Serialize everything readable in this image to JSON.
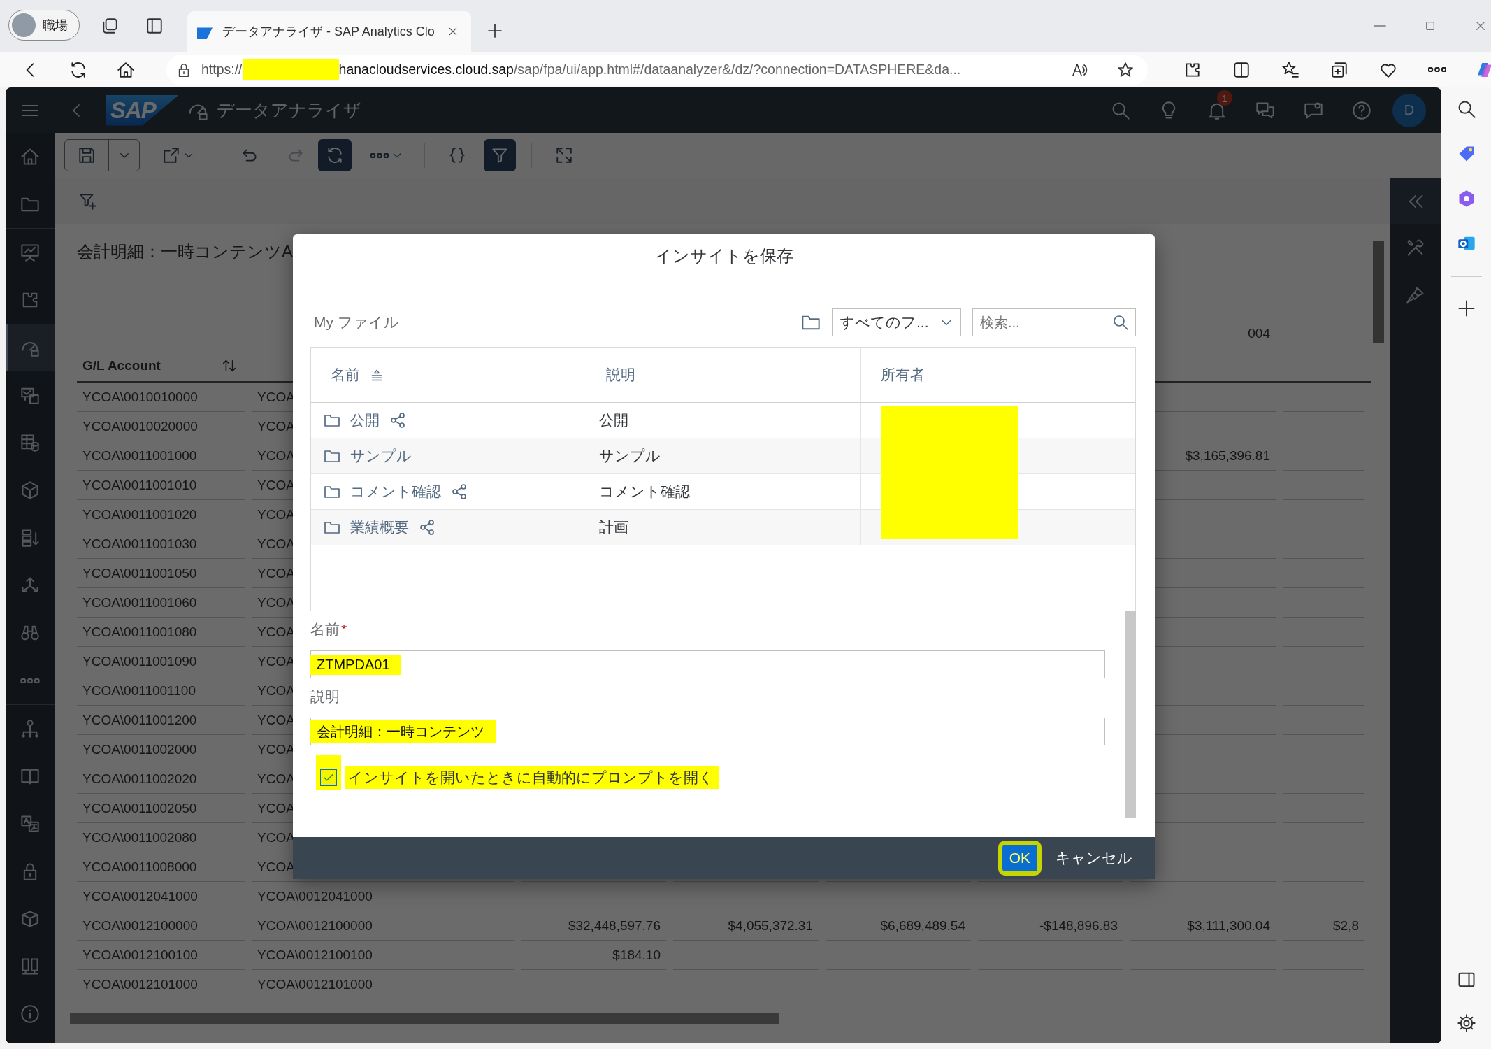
{
  "browser": {
    "profile": {
      "label": "職場"
    },
    "tabs": [
      {
        "title": "データアナライザ - SAP Analytics Clo",
        "selected": true
      }
    ],
    "address": {
      "scheme": "https://",
      "host_redacted": true,
      "host": "hanacloudservices.cloud.sap",
      "path": "/sap/fpa/ui/app.html#/dataanalyzer&/dz/?connection=DATASPHERE&da..."
    }
  },
  "shell": {
    "logo": "SAP",
    "title": "データアナライザ",
    "notification_count": "1",
    "avatar": "D"
  },
  "nav": [
    {
      "selected": false
    },
    {
      "selected": false
    },
    {
      "selected": false
    },
    {
      "selected": false
    },
    {
      "selected": true
    },
    {
      "selected": false
    },
    {
      "selected": false
    },
    {
      "selected": false
    },
    {
      "selected": false
    },
    {
      "selected": false
    },
    {
      "selected": false
    },
    {
      "selected": false
    },
    {
      "selected": false
    },
    {
      "selected": false
    },
    {
      "selected": false
    },
    {
      "selected": false
    },
    {
      "selected": false
    },
    {
      "selected": false
    },
    {
      "selected": false
    }
  ],
  "toolbar": [
    {
      "kind": "save",
      "active": false,
      "disabled": false
    },
    {
      "kind": "export",
      "active": false,
      "disabled": false
    },
    {
      "kind": "undo",
      "active": false,
      "disabled": false
    },
    {
      "kind": "redo",
      "active": false,
      "disabled": true
    },
    {
      "kind": "refresh",
      "active": true,
      "disabled": false
    },
    {
      "kind": "more",
      "active": false,
      "disabled": false
    },
    {
      "kind": "formula",
      "active": false,
      "disabled": false
    },
    {
      "kind": "filter",
      "active": true,
      "disabled": false
    },
    {
      "kind": "fullscreen",
      "active": false,
      "disabled": false
    }
  ],
  "report": {
    "title": "会計明細：一時コンテンツA",
    "account_header": "G/L Account",
    "period_header": "004",
    "rows": [
      {
        "account": "YCOA\\0010010000",
        "column_2": "YCOA"
      },
      {
        "account": "YCOA\\0010020000",
        "column_2": "YCOA"
      },
      {
        "account": "YCOA\\0011001000",
        "column_2": "YCOA",
        "column_7": "$3,165,396.81"
      },
      {
        "account": "YCOA\\0011001010",
        "column_2": "YCOA"
      },
      {
        "account": "YCOA\\0011001020",
        "column_2": "YCOA"
      },
      {
        "account": "YCOA\\0011001030",
        "column_2": "YCOA"
      },
      {
        "account": "YCOA\\0011001050",
        "column_2": "YCOA"
      },
      {
        "account": "YCOA\\0011001060",
        "column_2": "YCOA"
      },
      {
        "account": "YCOA\\0011001080",
        "column_2": "YCOA"
      },
      {
        "account": "YCOA\\0011001090",
        "column_2": "YCOA"
      },
      {
        "account": "YCOA\\0011001100",
        "column_2": "YCOA"
      },
      {
        "account": "YCOA\\0011001200",
        "column_2": "YCOA"
      },
      {
        "account": "YCOA\\0011002000",
        "column_2": "YCOA"
      },
      {
        "account": "YCOA\\0011002020",
        "column_2": "YCOA"
      },
      {
        "account": "YCOA\\0011002050",
        "column_2": "YCOA"
      },
      {
        "account": "YCOA\\0011002080",
        "column_2": "YCOA"
      },
      {
        "account": "YCOA\\0011008000",
        "column_2": "YCOA"
      },
      {
        "account": "YCOA\\0012041000",
        "column_2": "YCOA\\0012041000"
      },
      {
        "account": "YCOA\\0012100000",
        "column_2": "YCOA\\0012100000",
        "column_3": "$32,448,597.76",
        "column_4": "$4,055,372.31",
        "column_5": "$6,689,489.54",
        "column_6": "-$148,896.83",
        "column_7": "$3,111,300.04",
        "column_8": "$2,8"
      },
      {
        "account": "YCOA\\0012100100",
        "column_2": "YCOA\\0012100100",
        "column_3": "$184.10"
      },
      {
        "account": "YCOA\\0012101000",
        "column_2": "YCOA\\0012101000"
      }
    ]
  },
  "dialog": {
    "title": "インサイトを保存",
    "location": "My ファイル",
    "folder_filter": {
      "value": "すべてのフ..."
    },
    "search": {
      "placeholder": "検索..."
    },
    "columns": [
      {
        "label": "名前",
        "sorted": true
      },
      {
        "label": "説明",
        "sorted": false
      },
      {
        "label": "所有者",
        "sorted": false
      }
    ],
    "owner_redacted": true,
    "rows": [
      {
        "name": "公開",
        "shared": true,
        "description": "公開"
      },
      {
        "name": "サンプル",
        "shared": false,
        "description": "サンプル"
      },
      {
        "name": "コメント確認",
        "shared": true,
        "description": "コメント確認"
      },
      {
        "name": "業績概要",
        "shared": true,
        "description": "計画"
      }
    ],
    "fields": [
      {
        "label": "名前",
        "required_mark": "*",
        "value": "ZTMPDA01",
        "highlighted": true
      },
      {
        "label": "説明",
        "value": "会計明細：一時コンテンツ",
        "highlighted": true
      }
    ],
    "prompt_option": {
      "label": "インサイトを開いたときに自動的にプロンプトを開く",
      "checked": true,
      "highlighted": true
    },
    "buttons": [
      {
        "label": "OK",
        "kind": "emphasized",
        "highlighted": true
      },
      {
        "label": "キャンセル",
        "kind": "transparent",
        "highlighted": false
      }
    ]
  }
}
